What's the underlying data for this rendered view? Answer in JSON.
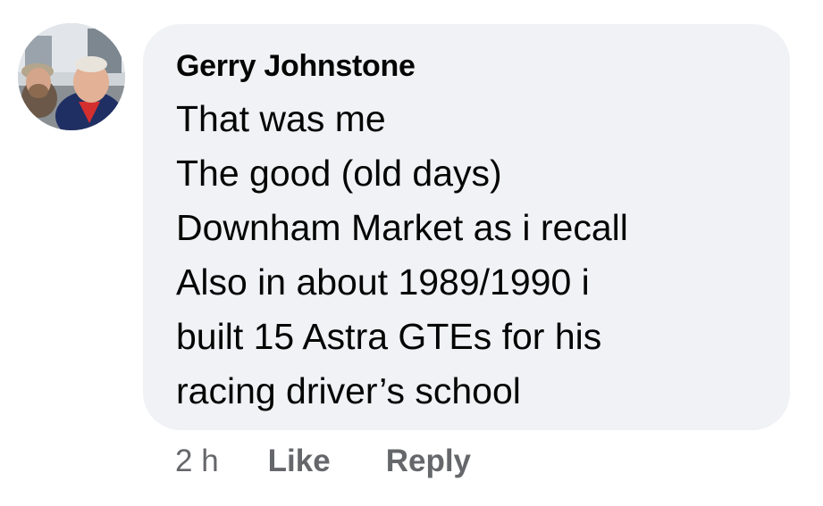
{
  "comment": {
    "author": "Gerry Johnstone",
    "lines": [
      "That was me",
      "The good (old days)",
      "Downham Market as i recall",
      "Also in about 1989/1990 i",
      "built 15 Astra GTEs for his",
      "racing driver’s school"
    ],
    "timestamp": "2 h",
    "like_label": "Like",
    "reply_label": "Reply"
  },
  "colors": {
    "bubble_bg": "#f0f2f5",
    "text": "#050505",
    "secondary_text": "#65676b"
  }
}
